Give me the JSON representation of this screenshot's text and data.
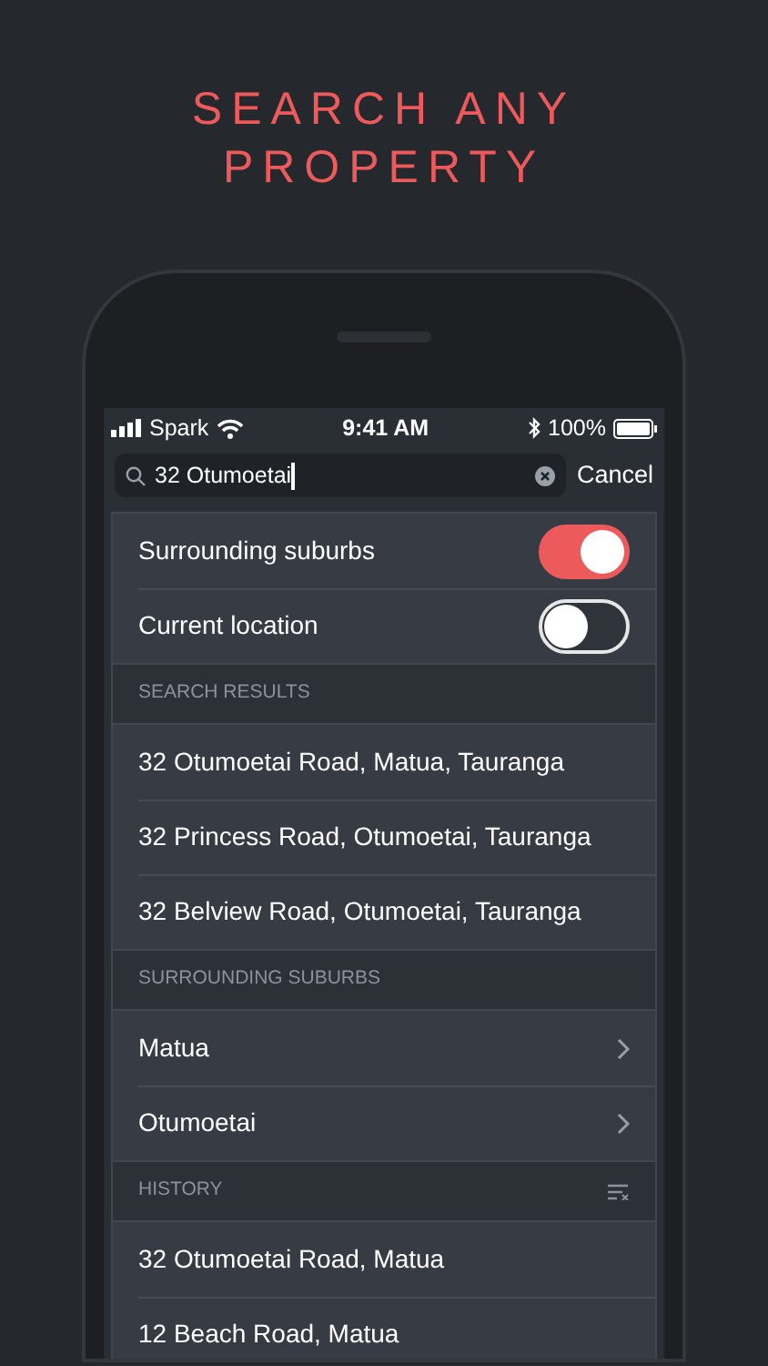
{
  "headline": "SEARCH ANY PROPERTY",
  "status_bar": {
    "carrier": "Spark",
    "time": "9:41 AM",
    "battery": "100%"
  },
  "search": {
    "value": "32 Otumoetai",
    "cancel": "Cancel"
  },
  "toggles": [
    {
      "label": "Surrounding suburbs",
      "on": true
    },
    {
      "label": "Current location",
      "on": false
    }
  ],
  "sections": [
    {
      "title": "SEARCH RESULTS",
      "clearable": false,
      "items": [
        {
          "label": "32 Otumoetai Road, Matua, Tauranga",
          "kind": "plain"
        },
        {
          "label": "32 Princess Road, Otumoetai, Tauranga",
          "kind": "plain"
        },
        {
          "label": "32 Belview Road, Otumoetai, Tauranga",
          "kind": "plain"
        }
      ]
    },
    {
      "title": "SURROUNDING SUBURBS",
      "clearable": false,
      "items": [
        {
          "label": "Matua",
          "kind": "link"
        },
        {
          "label": "Otumoetai",
          "kind": "link"
        }
      ]
    },
    {
      "title": "HISTORY",
      "clearable": true,
      "items": [
        {
          "label": "32 Otumoetai Road, Matua",
          "kind": "plain"
        },
        {
          "label": "12 Beach Road, Matua",
          "kind": "plain"
        }
      ]
    }
  ]
}
